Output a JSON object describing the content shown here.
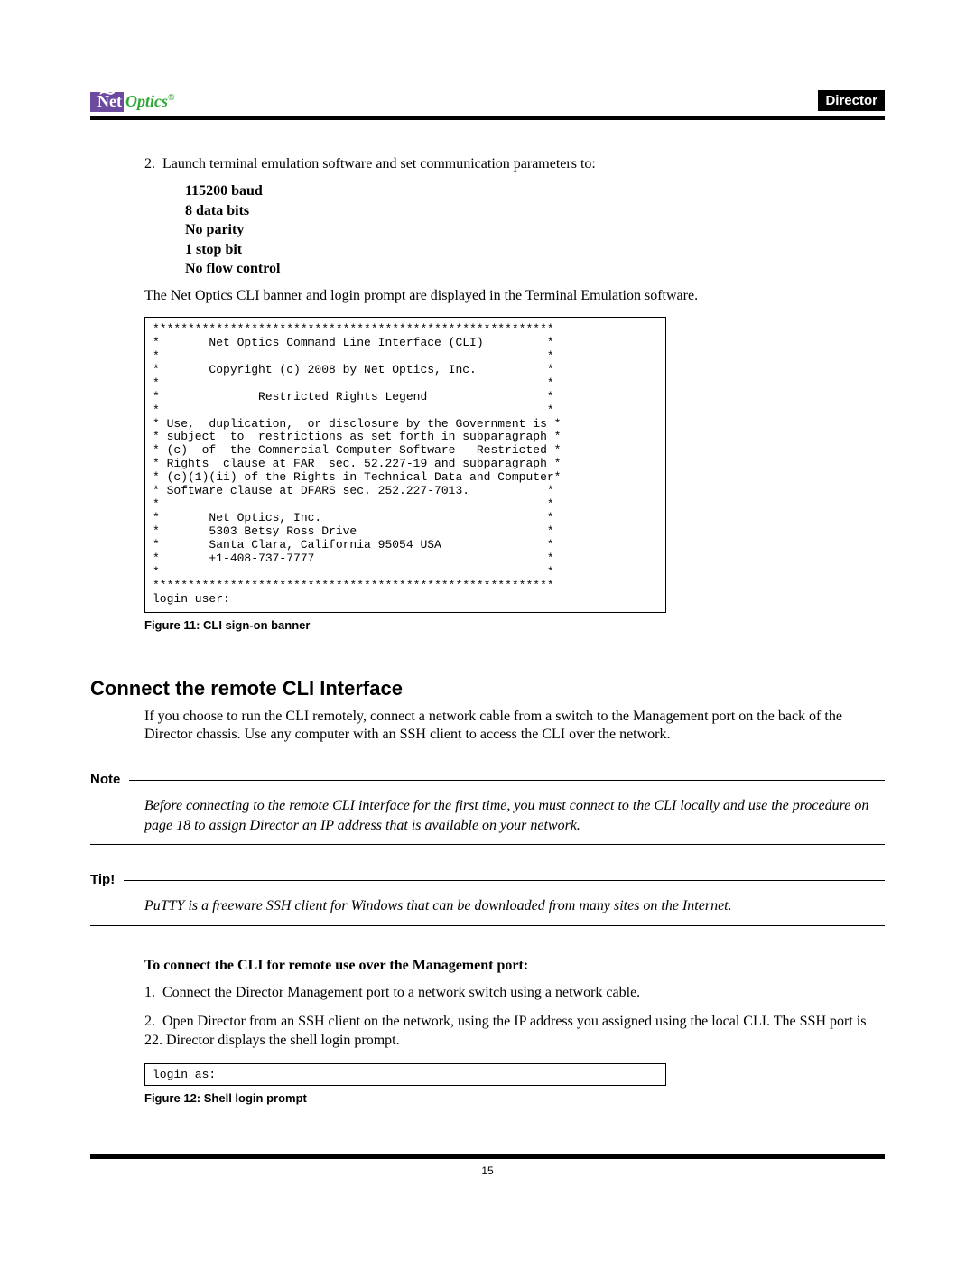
{
  "header": {
    "logo_net": "Net",
    "logo_optics": "Optics",
    "logo_reg": "®",
    "badge": "Director"
  },
  "step2": {
    "num": "2.",
    "text": "Launch terminal emulation software and set communication parameters to:",
    "params": [
      "115200 baud",
      "8 data bits",
      "No parity",
      "1 stop bit",
      "No flow control"
    ],
    "after": "The Net Optics CLI banner and login prompt are displayed in the Terminal Emulation software."
  },
  "terminal1": "*********************************************************\n*       Net Optics Command Line Interface (CLI)         *\n*                                                       *\n*       Copyright (c) 2008 by Net Optics, Inc.          *\n*                                                       *\n*              Restricted Rights Legend                 *\n*                                                       *\n* Use,  duplication,  or disclosure by the Government is *\n* subject  to  restrictions as set forth in subparagraph *\n* (c)  of  the Commercial Computer Software - Restricted *\n* Rights  clause at FAR  sec. 52.227-19 and subparagraph *\n* (c)(1)(ii) of the Rights in Technical Data and Computer*\n* Software clause at DFARS sec. 252.227-7013.           *\n*                                                       *\n*       Net Optics, Inc.                                *\n*       5303 Betsy Ross Drive                           *\n*       Santa Clara, California 95054 USA               *\n*       +1-408-737-7777                                 *\n*                                                       *\n*********************************************************\nlogin user:",
  "fig11": "Figure 11: CLI sign-on banner",
  "section": {
    "title": "Connect the remote CLI Interface",
    "body": "If you choose to run the CLI remotely, connect a network cable from a switch to the Management port on the back of the Director chassis. Use any computer with an SSH client to access the CLI over the network."
  },
  "note": {
    "label": "Note",
    "text": "Before connecting to the remote CLI interface for the first time, you must connect to the CLI locally and use the procedure on page 18 to assign Director an IP address that is available on your network."
  },
  "tip": {
    "label": "Tip!",
    "text": "PuTTY is a freeware SSH client for Windows that can be downloaded from many sites on the Internet."
  },
  "subhead": "To connect the CLI for remote use over the Management port:",
  "remote_steps": [
    {
      "num": "1.",
      "text": "Connect the Director Management port to a network switch using a network cable."
    },
    {
      "num": "2.",
      "text": "Open Director from an SSH client on the network, using the IP address you assigned using the local CLI. The SSH port is 22. Director displays the shell login prompt."
    }
  ],
  "terminal2": "login as:",
  "fig12": "Figure 12: Shell login prompt",
  "page_number": "15"
}
